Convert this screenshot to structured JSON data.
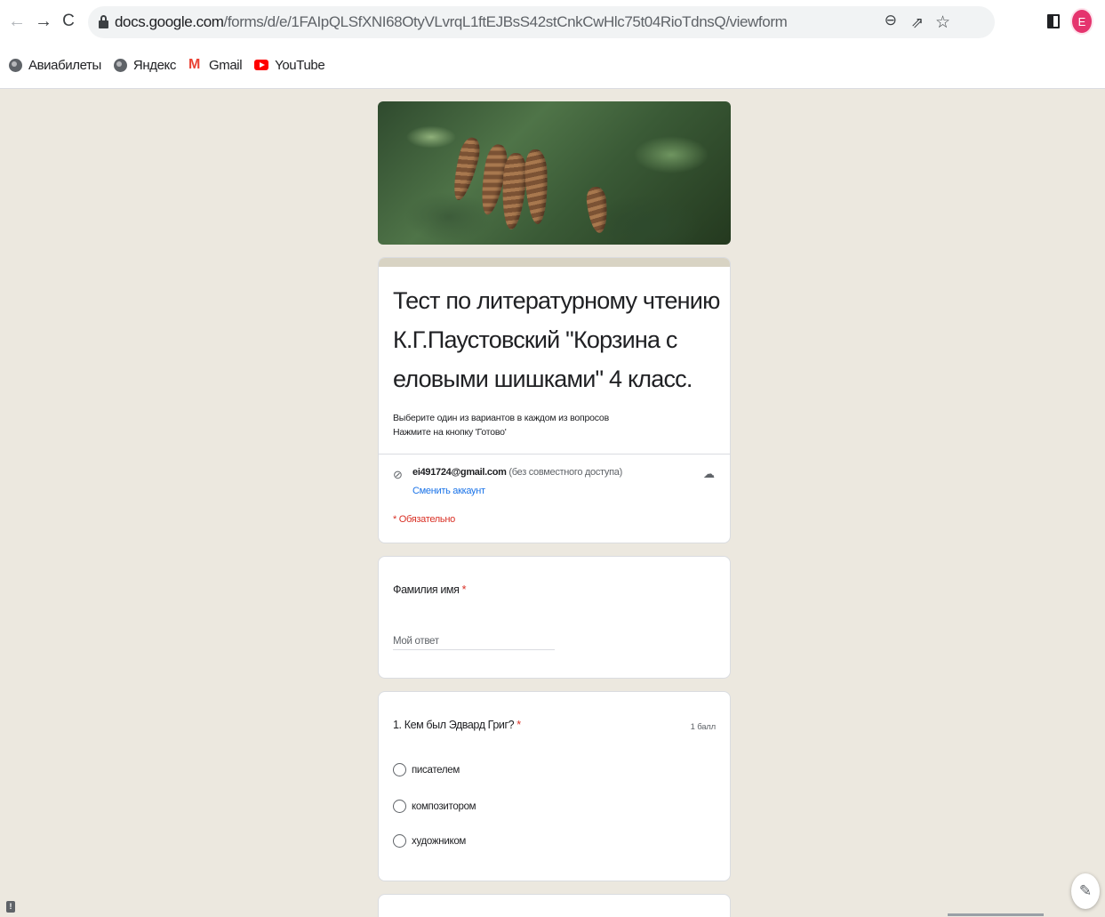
{
  "browser": {
    "url_host": "docs.google.com",
    "url_path": "/forms/d/e/1FAIpQLSfXNI68OtyVLvrqL1ftEJBsS42stCnkCwHlc75t04RioTdnsQ/viewform",
    "avatar_letter": "E",
    "accent_color": "#e5346e",
    "icons": {
      "back": "arrow-left-icon",
      "forward": "arrow-right-icon",
      "reload": "reload-icon",
      "lock": "lock-icon",
      "zoom": "zoom-icon",
      "share": "share-icon",
      "star": "star-icon",
      "side_panel": "side-panel-icon"
    }
  },
  "bookmarks": [
    {
      "label": "Авиабилеты",
      "icon": "globe-icon"
    },
    {
      "label": "Яндекс",
      "icon": "globe-icon"
    },
    {
      "label": "Gmail",
      "icon": "gmail-icon"
    },
    {
      "label": "YouTube",
      "icon": "youtube-icon"
    }
  ],
  "form": {
    "title": "Тест по литературному чтению К.Г.Паустовский \"Корзина с еловыми шишками\" 4 класс.",
    "description_line1": "Выберите один из вариантов в каждом из  вопросов",
    "description_line2": "Нажмите на кнопку 'Готово'",
    "account_email": "ei491724@gmail.com",
    "account_note": "(без совместного доступа)",
    "switch_account": "Сменить аккаунт",
    "required_note": "* Обязательно",
    "theme_color": "#d8d3c3",
    "background_color": "#ece8df",
    "required_color": "#d93025"
  },
  "questions": {
    "name": {
      "label": "Фамилия имя",
      "required_mark": "*",
      "placeholder": "Мой ответ"
    },
    "q1": {
      "label": "1. Кем был Эдвард Григ?",
      "required_mark": "*",
      "points": "1 балл",
      "options": [
        "писателем",
        "композитором",
        "художником"
      ]
    }
  }
}
